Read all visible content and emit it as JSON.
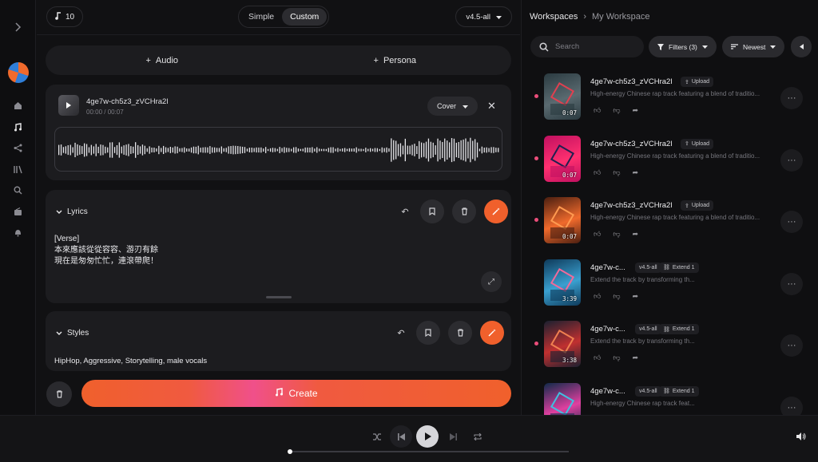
{
  "credits": {
    "icon": "music-note-icon",
    "value": "10"
  },
  "mode": {
    "simple": "Simple",
    "custom": "Custom",
    "active": "Custom"
  },
  "version": "v4.5-all",
  "add": {
    "audio": "Audio",
    "persona": "Persona"
  },
  "upload": {
    "title": "4ge7w-ch5z3_zVCHra2l",
    "time": "00:00 / 00:07",
    "cover_label": "Cover"
  },
  "lyrics": {
    "label": "Lyrics",
    "text": "[Verse]\n本來應該從從容容、游刃有餘\n現在是匆匆忙忙，連滾帶爬！"
  },
  "styles": {
    "label": "Styles",
    "text": "HipHop, Aggressive, Storytelling, male vocals"
  },
  "create_label": "Create",
  "workspace": {
    "root": "Workspaces",
    "current": "My Workspace",
    "search_placeholder": "Search",
    "filters": "Filters (3)",
    "sort": "Newest"
  },
  "songs": [
    {
      "title": "4ge7w-ch5z3_zVCHra2l",
      "tag1": "",
      "tag2": "Upload",
      "desc": "High-energy Chinese rap track featuring a blend of traditio...",
      "duration": "0:07",
      "new": true,
      "theme": "cube-dark"
    },
    {
      "title": "4ge7w-ch5z3_zVCHra2l",
      "tag1": "",
      "tag2": "Upload",
      "desc": "High-energy Chinese rap track featuring a blend of traditio...",
      "duration": "0:07",
      "new": true,
      "theme": "neon-pink"
    },
    {
      "title": "4ge7w-ch5z3_zVCHra2l",
      "tag1": "",
      "tag2": "Upload",
      "desc": "High-energy Chinese rap track featuring a blend of traditio...",
      "duration": "0:07",
      "new": true,
      "theme": "orange-cube"
    },
    {
      "title": "4ge7w-c...",
      "tag1": "v4.5-all",
      "tag2": "Extend 1",
      "desc": "Extend the track by transforming th...",
      "duration": "3:39",
      "new": false,
      "theme": "city-blue"
    },
    {
      "title": "4ge7w-c...",
      "tag1": "v4.5-all",
      "tag2": "Extend 1",
      "desc": "Extend the track by transforming th...",
      "duration": "3:38",
      "new": true,
      "theme": "city-red"
    },
    {
      "title": "4ge7w-c...",
      "tag1": "v4.5-all",
      "tag2": "Extend 1",
      "desc": "High-energy Chinese rap track feat...",
      "duration": "",
      "new": false,
      "theme": "city-pink"
    }
  ],
  "colors": {
    "accent": "#f0602c",
    "new_dot": "#ea4d7a",
    "panel": "#1c1c1f"
  }
}
